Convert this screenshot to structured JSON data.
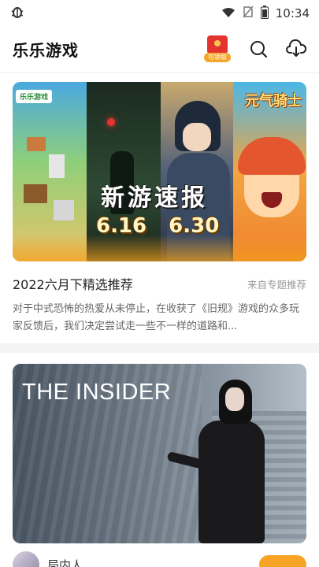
{
  "status_bar": {
    "left_icon": "bug-icon",
    "time": "10:34",
    "icons": [
      "wifi-icon",
      "sim-off-icon",
      "battery-icon"
    ]
  },
  "header": {
    "title": "乐乐游戏",
    "redpacket_tag": "可领取",
    "actions": [
      "redpacket-icon",
      "search-icon",
      "download-icon"
    ]
  },
  "feed": [
    {
      "banner": {
        "headline": "新游速报",
        "dates": [
          "6.16",
          "6.30"
        ],
        "top_left_logo": "乐乐游戏",
        "top_right_title": "元气骑士"
      },
      "title": "2022六月下精选推荐",
      "source": "来自专题推荐",
      "description": "对于中式恐怖的热爱从未停止，在收获了《旧规》游戏的众多玩家反馈后，我们决定尝试走一些不一样的道路和..."
    },
    {
      "banner": {
        "overlay_title": "THE INSIDER"
      },
      "name": "局内人"
    }
  ]
}
